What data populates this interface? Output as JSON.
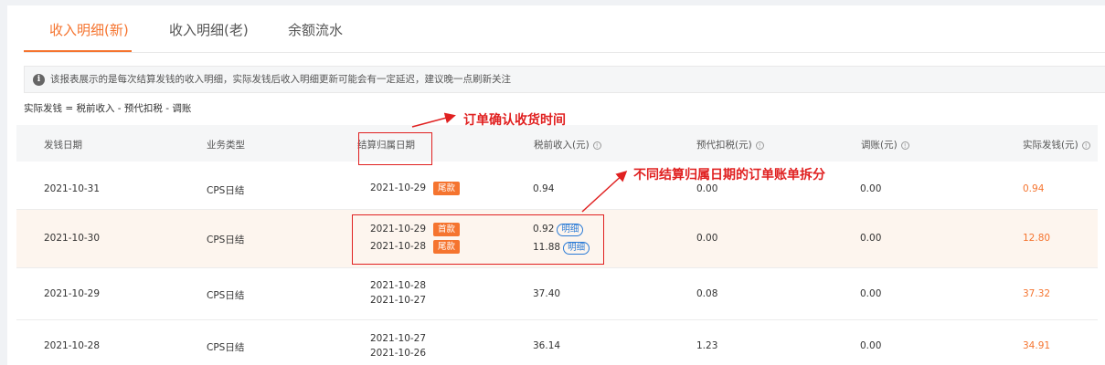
{
  "tabs": [
    {
      "label": "收入明细(新)",
      "active": true
    },
    {
      "label": "收入明细(老)",
      "active": false
    },
    {
      "label": "余额流水",
      "active": false
    }
  ],
  "notice": {
    "icon": "info-icon",
    "text": "该报表展示的是每次结算发钱的收入明细，实际发钱后收入明细更新可能会有一定延迟，建议晚一点刷新关注"
  },
  "formula": "实际发钱 = 税前收入 - 预代扣税 - 调账",
  "columns": [
    {
      "label": "发钱日期",
      "help": false
    },
    {
      "label": "业务类型",
      "help": false
    },
    {
      "label": "结算归属日期",
      "help": false
    },
    {
      "label": "税前收入(元)",
      "help": true
    },
    {
      "label": "预代扣税(元)",
      "help": true
    },
    {
      "label": "调账(元)",
      "help": true
    },
    {
      "label": "实际发钱(元)",
      "help": true
    }
  ],
  "rows": [
    {
      "pay_date": "2021-10-31",
      "biz_type": "CPS日结",
      "settle_dates": [
        {
          "date": "2021-10-29",
          "tag": "尾款"
        }
      ],
      "pretax": [
        {
          "value": "0.94",
          "detail": ""
        }
      ],
      "tax": "0.00",
      "adjust": "0.00",
      "actual": "0.94"
    },
    {
      "pay_date": "2021-10-30",
      "biz_type": "CPS日结",
      "settle_dates": [
        {
          "date": "2021-10-29",
          "tag": "首款"
        },
        {
          "date": "2021-10-28",
          "tag": "尾款"
        }
      ],
      "pretax": [
        {
          "value": "0.92",
          "detail": "明细"
        },
        {
          "value": "11.88",
          "detail": "明细"
        }
      ],
      "tax": "0.00",
      "adjust": "0.00",
      "actual": "12.80"
    },
    {
      "pay_date": "2021-10-29",
      "biz_type": "CPS日结",
      "settle_dates": [
        {
          "date": "2021-10-28",
          "tag": ""
        },
        {
          "date": "2021-10-27",
          "tag": ""
        }
      ],
      "pretax": [
        {
          "value": "37.40",
          "detail": ""
        }
      ],
      "tax": "0.08",
      "adjust": "0.00",
      "actual": "37.32"
    },
    {
      "pay_date": "2021-10-28",
      "biz_type": "CPS日结",
      "settle_dates": [
        {
          "date": "2021-10-27",
          "tag": ""
        },
        {
          "date": "2021-10-26",
          "tag": ""
        }
      ],
      "pretax": [
        {
          "value": "36.14",
          "detail": ""
        }
      ],
      "tax": "1.23",
      "adjust": "0.00",
      "actual": "34.91"
    }
  ],
  "annotations": {
    "order_time": "订单确认收货时间",
    "split": "不同结算归属日期的订单账单拆分",
    "color": "#e02020"
  },
  "colors": {
    "accent": "#f5742f",
    "link": "#2b7bd6"
  }
}
